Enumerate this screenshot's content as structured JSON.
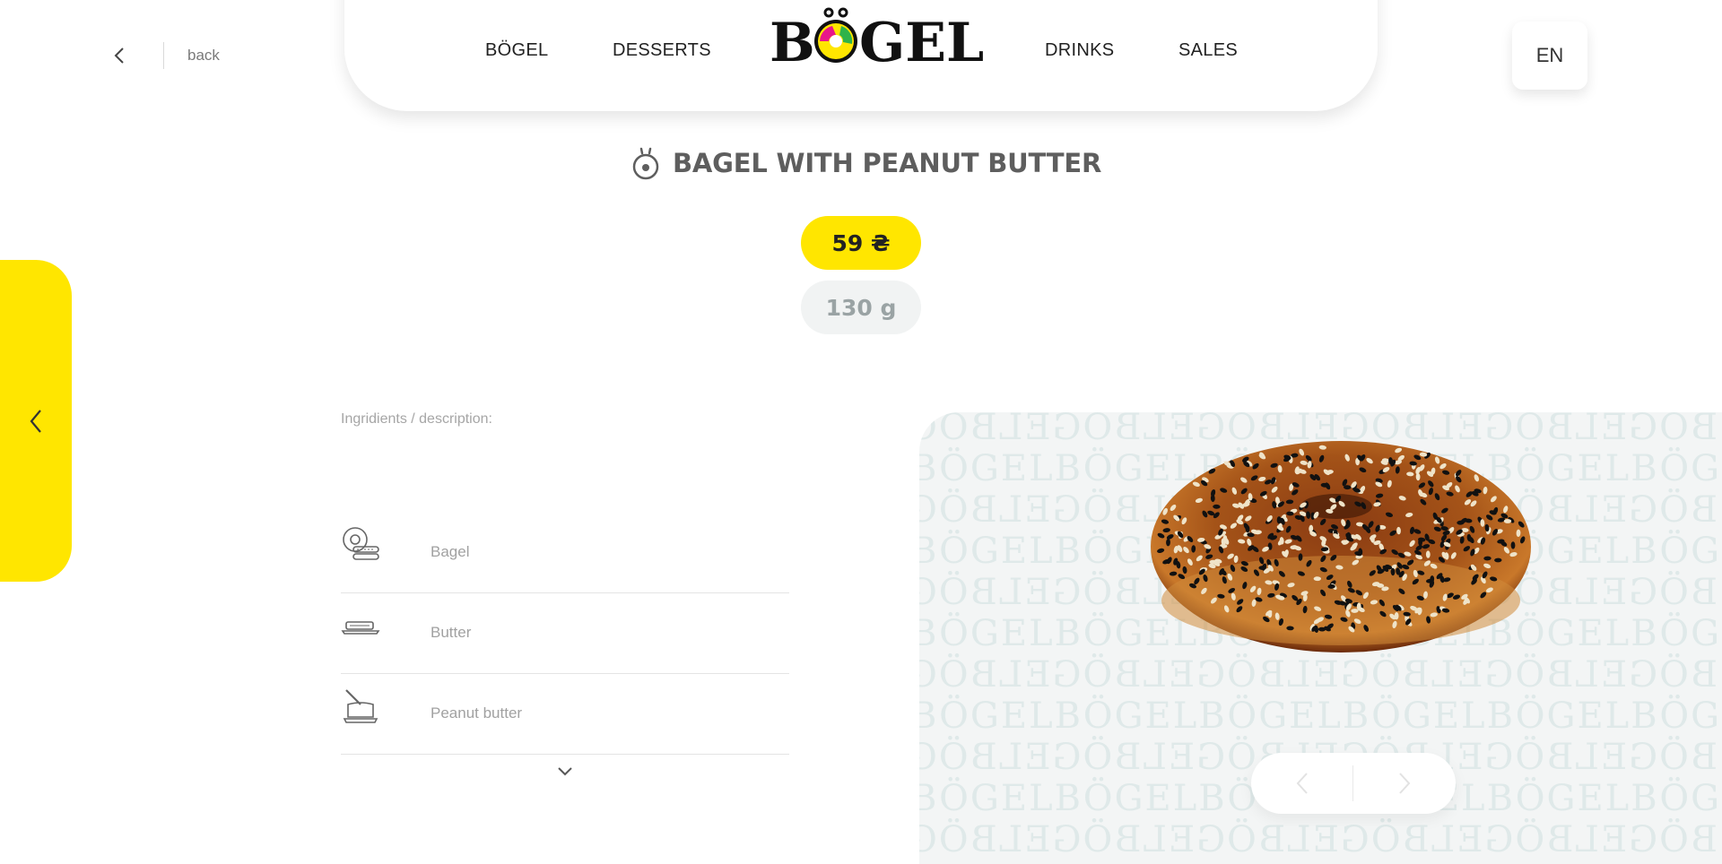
{
  "back": {
    "label": "back"
  },
  "nav": {
    "left": [
      "BÖGEL",
      "DESSERTS"
    ],
    "right": [
      "DRINKS",
      "SALES"
    ],
    "logo_text": "BÖGEL"
  },
  "language": "EN",
  "product": {
    "title": "BAGEL WITH PEANUT BUTTER",
    "price": "59 ₴",
    "weight": "130 g"
  },
  "ingredients": {
    "heading": "Ingridients / description:",
    "items": [
      {
        "label": "Bagel",
        "icon": "bagel-icon"
      },
      {
        "label": "Butter",
        "icon": "butter-icon"
      },
      {
        "label": "Peanut butter",
        "icon": "peanut-butter-icon"
      }
    ]
  },
  "image": {
    "pattern_text": "BÖGELBÖGELBÖGELBÖGELBÖGELBÖGELBÖGEL"
  },
  "colors": {
    "accent": "#ffe600",
    "weight_bg": "#f1f3f3",
    "panel_bg": "#f3f5f5",
    "title": "#5e5e5e"
  }
}
